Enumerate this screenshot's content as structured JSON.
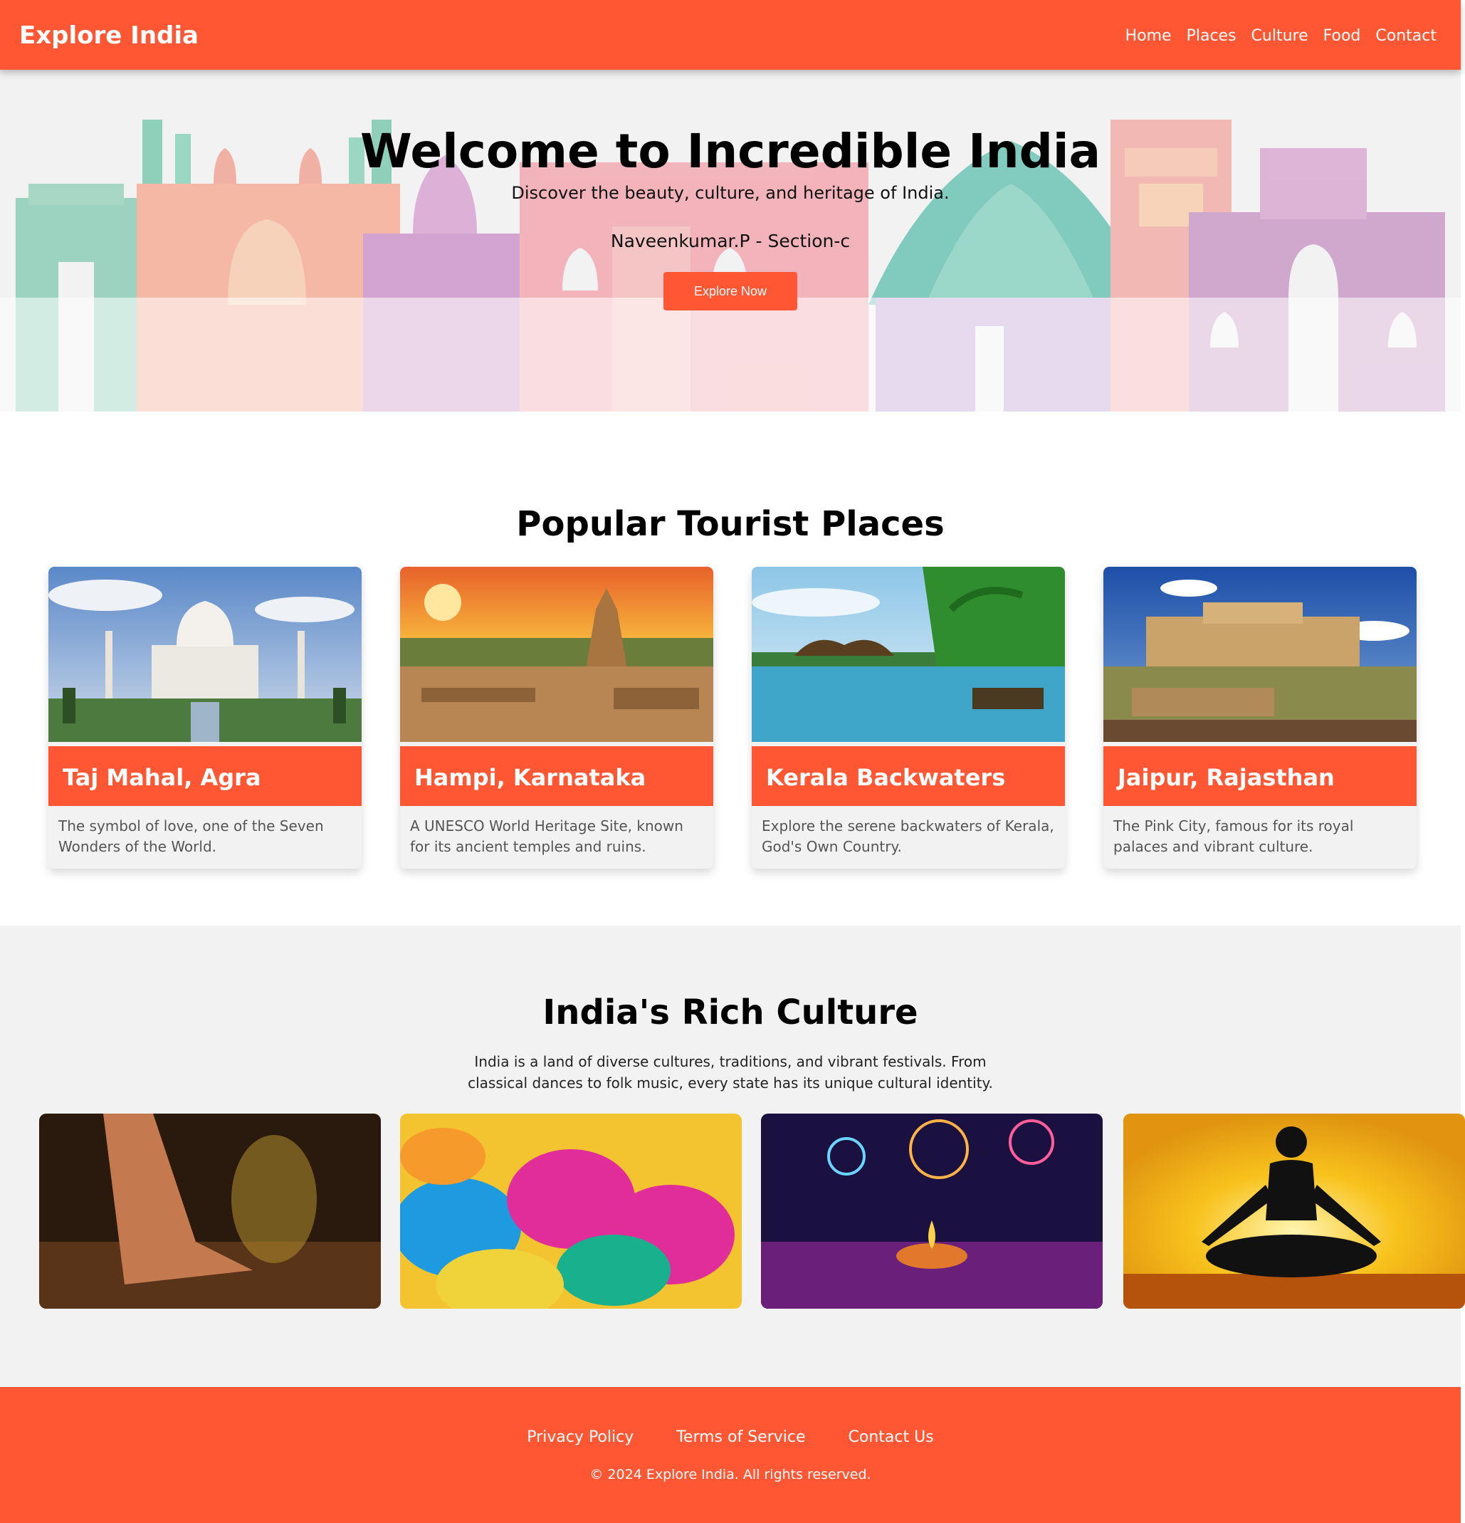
{
  "navbar": {
    "brand": "Explore India",
    "links": [
      "Home",
      "Places",
      "Culture",
      "Food",
      "Contact"
    ]
  },
  "hero": {
    "title": "Welcome to Incredible India",
    "subtitle": "Discover the beauty, culture, and heritage of India.",
    "author": "Naveenkumar.P - Section-c",
    "button": "Explore Now"
  },
  "places": {
    "title": "Popular Tourist Places",
    "cards": [
      {
        "title": "Taj Mahal, Agra",
        "desc": "The symbol of love, one of the Seven Wonders of the World.",
        "image": "taj-mahal-photo"
      },
      {
        "title": "Hampi, Karnataka",
        "desc": "A UNESCO World Heritage Site, known for its ancient temples and ruins.",
        "image": "hampi-temple-photo"
      },
      {
        "title": "Kerala Backwaters",
        "desc": "Explore the serene backwaters of Kerala, God's Own Country.",
        "image": "kerala-backwaters-photo"
      },
      {
        "title": "Jaipur, Rajasthan",
        "desc": "The Pink City, famous for its royal palaces and vibrant culture.",
        "image": "jaipur-fort-photo"
      }
    ]
  },
  "culture": {
    "title": "India's Rich Culture",
    "text": "India is a land of diverse cultures, traditions, and vibrant festivals. From classical dances to folk music, every state has its unique cultural identity.",
    "images": [
      "classical-dance-photo",
      "holi-colors-photo",
      "diwali-festival-photo",
      "yoga-silhouette-photo"
    ]
  },
  "footer": {
    "links": [
      "Privacy Policy",
      "Terms of Service",
      "Contact Us"
    ],
    "copyright": "© 2024 Explore India. All rights reserved."
  },
  "colors": {
    "accent": "#ff5733",
    "section_gray": "#f2f2f2",
    "text_dark": "#111111",
    "text_muted": "#555555"
  }
}
